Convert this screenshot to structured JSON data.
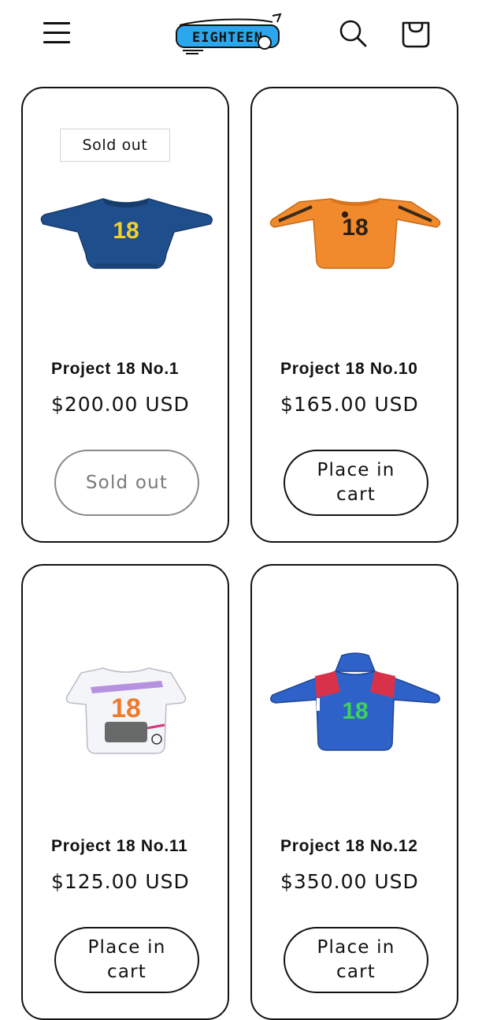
{
  "header": {
    "logo_text": "EIGHTEEN",
    "menu_icon": "hamburger-menu-icon",
    "search_icon": "search-icon",
    "cart_icon": "cart-bag-icon"
  },
  "products": [
    {
      "title": "Project 18 No.1",
      "price": "$200.00 USD",
      "badge": "Sold out",
      "button_label": "Sold out",
      "image_alt": "Blue crewneck sweatshirt with yellow 18"
    },
    {
      "title": "Project 18 No.10",
      "price": "$165.00 USD",
      "badge": "",
      "button_label": "Place in cart",
      "image_alt": "Orange long sleeve shirt with 18 print"
    },
    {
      "title": "Project 18 No.11",
      "price": "$125.00 USD",
      "badge": "",
      "button_label": "Place in cart",
      "image_alt": "White graphic t-shirt with orange 18"
    },
    {
      "title": "Project 18 No.12",
      "price": "$350.00 USD",
      "badge": "",
      "button_label": "Place in cart",
      "image_alt": "Blue and red hoodie with green 18"
    }
  ],
  "colors": {
    "text": "#121212",
    "border": "#121212",
    "disabled": "#7a7a7a",
    "shirt_blue": "#1f4e8c",
    "shirt_orange": "#f08a2c",
    "hoodie_blue": "#2f62c9",
    "hoodie_red": "#d8314a"
  }
}
